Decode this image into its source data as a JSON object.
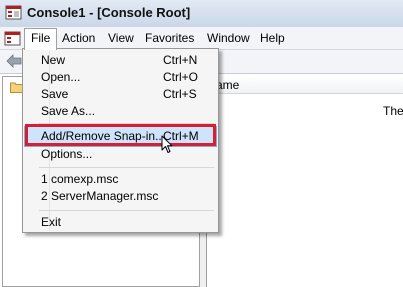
{
  "window": {
    "title": "Console1 - [Console Root]"
  },
  "menubar": {
    "items": [
      {
        "label": "File"
      },
      {
        "label": "Action"
      },
      {
        "label": "View"
      },
      {
        "label": "Favorites"
      },
      {
        "label": "Window"
      },
      {
        "label": "Help"
      }
    ]
  },
  "file_menu": {
    "new": {
      "label": "New",
      "shortcut": "Ctrl+N"
    },
    "open": {
      "label": "Open...",
      "shortcut": "Ctrl+O"
    },
    "save": {
      "label": "Save",
      "shortcut": "Ctrl+S"
    },
    "save_as": {
      "label": "Save As..."
    },
    "add_remove_snapin": {
      "label": "Add/Remove Snap-in...",
      "shortcut": "Ctrl+M"
    },
    "options": {
      "label": "Options..."
    },
    "recent1": {
      "label": "1 comexp.msc"
    },
    "recent2": {
      "label": "2 ServerManager.msc"
    },
    "exit": {
      "label": "Exit"
    }
  },
  "content": {
    "column_header": "ame",
    "right_text": "Ther"
  },
  "colors": {
    "highlight_border": "#d42032",
    "selection_fill": "#cfe4fb"
  },
  "icons": [
    "mmc-console-icon",
    "back-arrow-icon",
    "folder-icon",
    "mouse-cursor-icon"
  ]
}
